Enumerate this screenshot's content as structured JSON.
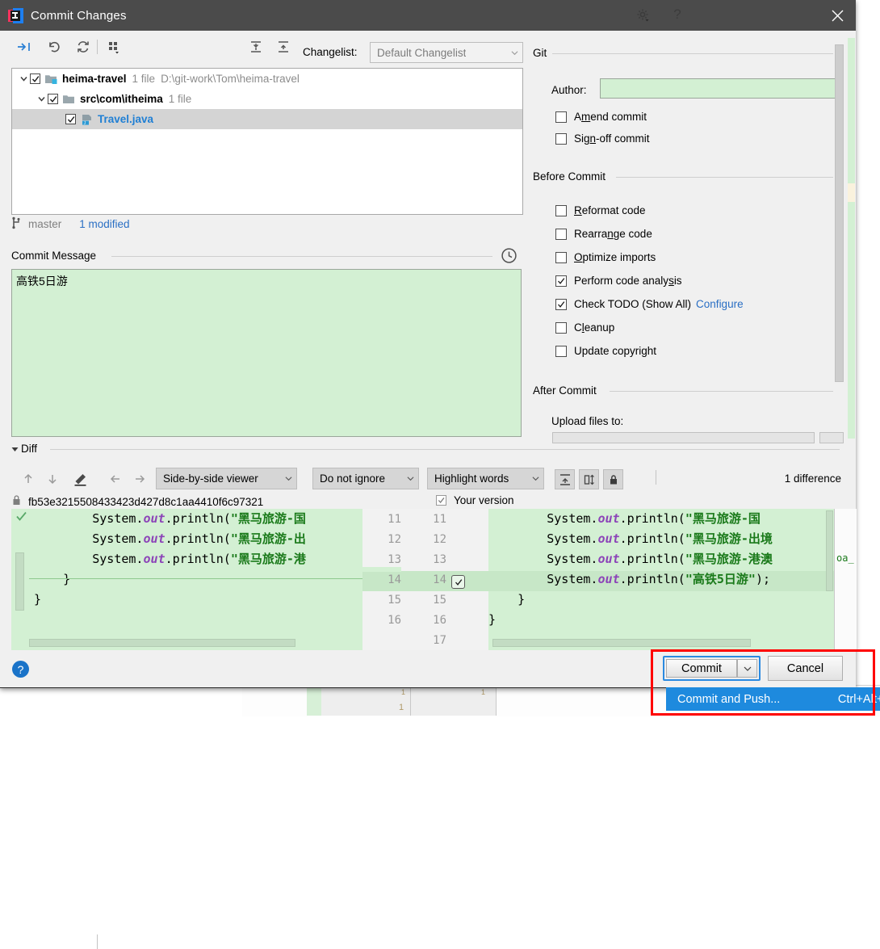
{
  "window": {
    "title": "Commit Changes",
    "app_icon": "intellij-idea-icon",
    "close_icon": "close-icon"
  },
  "toolbar": {
    "icons": [
      "show-diff-icon",
      "revert-icon",
      "refresh-icon",
      "group-by-icon",
      "expand-all-icon",
      "collapse-all-icon"
    ],
    "changelist_label": "Changelist:",
    "changelist_value": "Default Changelist"
  },
  "tree": {
    "rows": [
      {
        "name": "heima-travel",
        "files": "1 file",
        "path": "D:\\git-work\\Tom\\heima-travel",
        "checked": true,
        "expanded": true,
        "selected": false,
        "icon": "module-icon",
        "depth": 0
      },
      {
        "name": "src\\com\\itheima",
        "files": "1 file",
        "path": "",
        "checked": true,
        "expanded": true,
        "selected": false,
        "icon": "folder-icon",
        "depth": 1
      },
      {
        "name": "Travel.java",
        "files": "",
        "path": "",
        "checked": true,
        "expanded": null,
        "selected": true,
        "icon": "java-file-icon",
        "depth": 2
      }
    ]
  },
  "status": {
    "branch_icon": "branch-icon",
    "branch": "master",
    "modified": "1 modified"
  },
  "commit_message": {
    "label": "Commit Message",
    "value": "高铁5日游",
    "history_icon": "clock-icon"
  },
  "git_section": {
    "title": "Git",
    "author_label": "Author:",
    "author_value": "",
    "checkboxes": [
      {
        "label": "Amend commit",
        "mnemonic_index": 1,
        "checked": false
      },
      {
        "label": "Sign-off commit",
        "mnemonic_index": 3,
        "checked": false
      }
    ]
  },
  "before_commit": {
    "title": "Before Commit",
    "checkboxes": [
      {
        "label": "Reformat code",
        "mnemonic_index": 0,
        "checked": false
      },
      {
        "label": "Rearrange code",
        "mnemonic_index": 7,
        "checked": false
      },
      {
        "label": "Optimize imports",
        "mnemonic_index": 0,
        "checked": false
      },
      {
        "label": "Perform code analysis",
        "mnemonic_index": 18,
        "checked": true
      },
      {
        "label": "Check TODO (Show All)",
        "mnemonic_index": -1,
        "checked": true,
        "link": "Configure"
      },
      {
        "label": "Cleanup",
        "mnemonic_index": 1,
        "checked": false
      },
      {
        "label": "Update copyright",
        "mnemonic_index": -1,
        "checked": false
      }
    ]
  },
  "after_commit": {
    "title": "After Commit",
    "upload_label": "Upload files to:",
    "upload_value": ""
  },
  "diff": {
    "section_title": "Diff",
    "nav_icons": [
      "prev-difference-icon",
      "next-difference-icon",
      "edit-source-icon",
      "apply-left-icon",
      "apply-right-icon"
    ],
    "viewer_mode": "Side-by-side viewer",
    "ignore_mode": "Do not ignore",
    "highlight_mode": "Highlight words",
    "action_icons": [
      "collapse-unchanged-icon",
      "compare-side-icon",
      "lock-icon",
      "settings-icon",
      "help-icon"
    ],
    "difference_count": "1 difference",
    "left_title": "fb53e3215508433423d427d8c1aa4410f6c97321",
    "left_title_icon": "lock-icon",
    "right_title": "Your version",
    "right_title_checked": true,
    "left_lines": [
      {
        "num": "11",
        "prefix": "        System.",
        "kw": "out",
        "mid": ".println(",
        "str": "\"黑马旅游-国",
        "suffix": ""
      },
      {
        "num": "12",
        "prefix": "        System.",
        "kw": "out",
        "mid": ".println(",
        "str": "\"黑马旅游-出",
        "suffix": ""
      },
      {
        "num": "13",
        "prefix": "        System.",
        "kw": "out",
        "mid": ".println(",
        "str": "\"黑马旅游-港",
        "suffix": ""
      },
      {
        "num": "14",
        "prefix": "    }",
        "kw": "",
        "mid": "",
        "str": "",
        "suffix": ""
      },
      {
        "num": "15",
        "prefix": "}",
        "kw": "",
        "mid": "",
        "str": "",
        "suffix": ""
      },
      {
        "num": "16",
        "prefix": "",
        "kw": "",
        "mid": "",
        "str": "",
        "suffix": ""
      }
    ],
    "right_lines": [
      {
        "num": "11",
        "prefix": "        System.",
        "kw": "out",
        "mid": ".println(",
        "str": "\"黑马旅游-国",
        "suffix": "",
        "added": false
      },
      {
        "num": "12",
        "prefix": "        System.",
        "kw": "out",
        "mid": ".println(",
        "str": "\"黑马旅游-出境",
        "suffix": "",
        "added": false
      },
      {
        "num": "13",
        "prefix": "        System.",
        "kw": "out",
        "mid": ".println(",
        "str": "\"黑马旅游-港澳",
        "suffix": "",
        "added": false
      },
      {
        "num": "14",
        "prefix": "        System.",
        "kw": "out",
        "mid": ".println(",
        "str": "\"高铁5日游\"",
        "suffix": ");",
        "added": true
      },
      {
        "num": "15",
        "prefix": "    }",
        "kw": "",
        "mid": "",
        "str": "",
        "suffix": "",
        "added": false
      },
      {
        "num": "16",
        "prefix": "}",
        "kw": "",
        "mid": "",
        "str": "",
        "suffix": "",
        "added": false
      },
      {
        "num": "17",
        "prefix": "",
        "kw": "",
        "mid": "",
        "str": "",
        "suffix": "",
        "added": false
      }
    ],
    "change_accept_checked": true
  },
  "footer": {
    "help_icon": "?",
    "commit_label": "Commit",
    "commit_dropdown_icon": "chevron-down-icon",
    "cancel_label": "Cancel",
    "menu_item_label": "Commit and Push...",
    "menu_item_shortcut": "Ctrl+Alt+K"
  },
  "colors": {
    "titlebar_bg": "#4b4b4b",
    "dialog_bg": "#f0f0f0",
    "added_green": "#d3f0d3",
    "link_blue": "#2a6fc4",
    "accent_blue": "#1e8ade",
    "annotation_red": "#ff0000",
    "string_green": "#1a7a1a",
    "keyword_purple": "#8c44b8"
  }
}
